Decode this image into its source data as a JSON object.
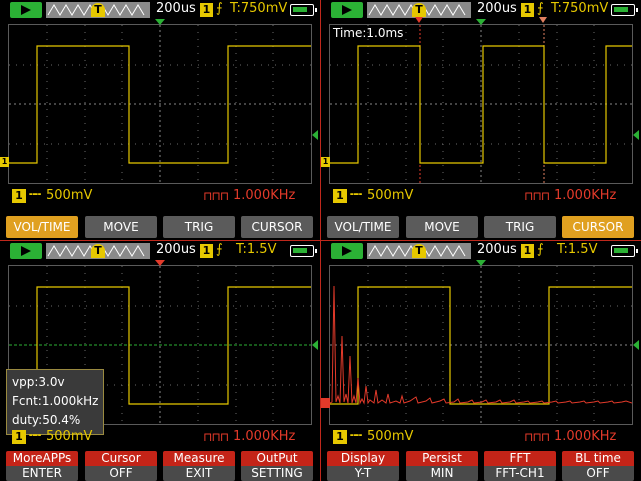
{
  "colors": {
    "ch1": "#e6c800",
    "accent_red": "#e33a2a",
    "run_green": "#2bb135",
    "active_orange": "#e0a020",
    "button_grey": "#5b5b5b"
  },
  "panels": [
    {
      "status": {
        "timebase": "200us",
        "channel": "1",
        "trigger_label": "T:750mV",
        "trigger_marker": "T"
      },
      "info": {
        "ch1_badge": "1",
        "volts_div": "500mV",
        "freq": "1.000KHz"
      },
      "menu": [
        "VOL/TIME",
        "MOVE",
        "TRIG",
        "CURSOR"
      ],
      "active_index": 0
    },
    {
      "status": {
        "timebase": "200us",
        "channel": "1",
        "trigger_label": "T:750mV",
        "trigger_marker": "T"
      },
      "overlay_label": "Time:1.0ms",
      "info": {
        "ch1_badge": "1",
        "volts_div": "500mV",
        "freq": "1.000KHz"
      },
      "menu": [
        "VOL/TIME",
        "MOVE",
        "TRIG",
        "CURSOR"
      ],
      "active_index": 3
    },
    {
      "status": {
        "timebase": "200us",
        "channel": "1",
        "trigger_label": "T:1.5V",
        "trigger_marker": "T"
      },
      "measurements": [
        "vpp:3.0v",
        "Fcnt:1.000kHz",
        "duty:50.4%"
      ],
      "info": {
        "ch1_badge": "1",
        "volts_div": "500mV",
        "freq": "1.000KHz"
      },
      "menu": [
        {
          "top": "MoreAPPs",
          "bottom": "ENTER"
        },
        {
          "top": "Cursor",
          "bottom": "OFF"
        },
        {
          "top": "Measure",
          "bottom": "EXIT"
        },
        {
          "top": "OutPut",
          "bottom": "SETTING"
        }
      ]
    },
    {
      "status": {
        "timebase": "200us",
        "channel": "1",
        "trigger_label": "T:1.5V",
        "trigger_marker": "T"
      },
      "info": {
        "ch1_badge": "1",
        "volts_div": "500mV",
        "freq": "1.000KHz"
      },
      "menu": [
        {
          "top": "Display",
          "bottom": "Y-T"
        },
        {
          "top": "Persist",
          "bottom": "MIN"
        },
        {
          "top": "FFT",
          "bottom": "FFT-CH1"
        },
        {
          "top": "BL time",
          "bottom": "OFF"
        }
      ]
    }
  ],
  "icons": {
    "run": "play-icon",
    "battery": "battery-icon",
    "coupling": "dc-coupling-icon",
    "freq": "square-wave-icon"
  }
}
